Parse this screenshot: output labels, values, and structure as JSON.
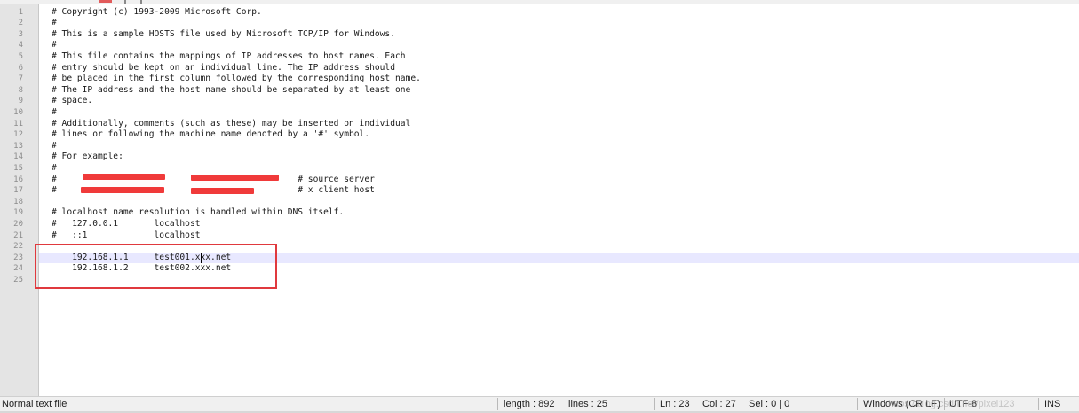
{
  "editor": {
    "lines": [
      {
        "num": "1",
        "text": "# Copyright (c) 1993-2009 Microsoft Corp."
      },
      {
        "num": "2",
        "text": "#"
      },
      {
        "num": "3",
        "text": "# This is a sample HOSTS file used by Microsoft TCP/IP for Windows."
      },
      {
        "num": "4",
        "text": "#"
      },
      {
        "num": "5",
        "text": "# This file contains the mappings of IP addresses to host names. Each"
      },
      {
        "num": "6",
        "text": "# entry should be kept on an individual line. The IP address should"
      },
      {
        "num": "7",
        "text": "# be placed in the first column followed by the corresponding host name."
      },
      {
        "num": "8",
        "text": "# The IP address and the host name should be separated by at least one"
      },
      {
        "num": "9",
        "text": "# space."
      },
      {
        "num": "10",
        "text": "#"
      },
      {
        "num": "11",
        "text": "# Additionally, comments (such as these) may be inserted on individual"
      },
      {
        "num": "12",
        "text": "# lines or following the machine name denoted by a '#' symbol."
      },
      {
        "num": "13",
        "text": "#"
      },
      {
        "num": "14",
        "text": "# For example:"
      },
      {
        "num": "15",
        "text": "#"
      },
      {
        "num": "16",
        "text": "#                                               # source server"
      },
      {
        "num": "17",
        "text": "#                                               # x client host"
      },
      {
        "num": "18",
        "text": ""
      },
      {
        "num": "19",
        "text": "# localhost name resolution is handled within DNS itself."
      },
      {
        "num": "20",
        "text": "#   127.0.0.1       localhost"
      },
      {
        "num": "21",
        "text": "#   ::1             localhost"
      },
      {
        "num": "22",
        "text": ""
      },
      {
        "num": "23",
        "text": "    192.168.1.1     test001.xxx.net"
      },
      {
        "num": "24",
        "text": "    192.168.1.2     test002.xxx.net"
      },
      {
        "num": "25",
        "text": ""
      }
    ]
  },
  "status": {
    "file_type": "Normal text file",
    "length": "length : 892",
    "lines": "lines : 25",
    "ln": "Ln : 23",
    "col": "Col : 27",
    "sel": "Sel : 0 | 0",
    "eol": "Windows (CR LF)",
    "encoding": "UTF-8",
    "mode": "INS",
    "watermark": "https://blog.csdn.net/pixel123"
  },
  "colors": {
    "current_line": "#e8e8ff",
    "redaction": "#f03a3a",
    "annotation_box": "#e0393e"
  }
}
